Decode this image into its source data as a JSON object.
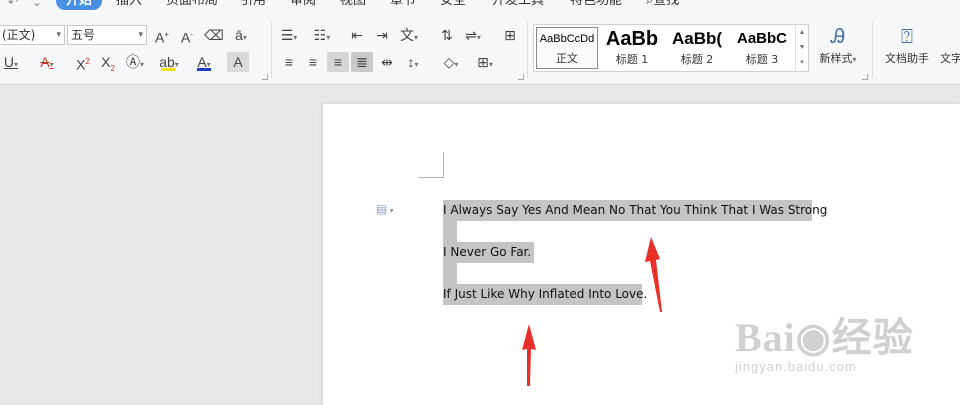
{
  "menu": {
    "quick_access": [
      "↶",
      "⌄"
    ],
    "tabs": [
      "开始",
      "插入",
      "页面布局",
      "引用",
      "审阅",
      "视图",
      "章节",
      "安全",
      "开发工具",
      "特色功能",
      "查找"
    ]
  },
  "ribbon": {
    "font_name": "(正文)",
    "font_size": "五号",
    "styles": [
      {
        "sample": "AaBbCcDd",
        "name": "正文"
      },
      {
        "sample": "AaBb",
        "name": "标题 1"
      },
      {
        "sample": "AaBb(",
        "name": "标题 2"
      },
      {
        "sample": "AaBbC",
        "name": "标题 3"
      }
    ],
    "new_style_label": "新样式",
    "doc_assistant_label": "文档助手",
    "text_tool_label": "文字"
  },
  "document": {
    "lines": [
      "I Always Say Yes And Mean No That You Think That I Was Strong",
      "I Never Go Far.",
      "If Just Like Why Inflated Into Love."
    ]
  },
  "watermark": {
    "logo": "Bai◉经验",
    "url": "jingyan.baidu.com"
  },
  "colors": {
    "active_tab": "#4a90e2",
    "selection": "#c4c4c4",
    "arrow": "#e8302a",
    "font_color_bar": "#1f3fbf",
    "highlight_bar": "#f2e200"
  }
}
